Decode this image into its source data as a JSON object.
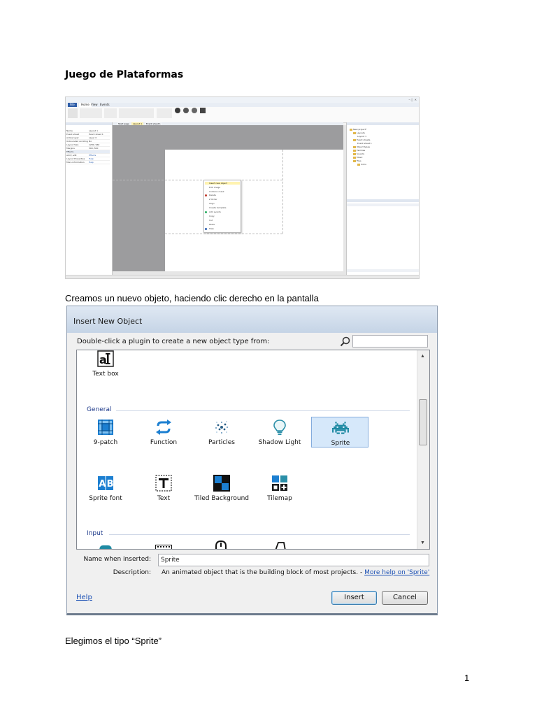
{
  "document": {
    "title": "Juego de Plataformas",
    "caption_1": "Creamos un nuevo objeto, haciendo clic derecho en la pantalla",
    "caption_2": "Elegimos el tipo “Sprite”",
    "page_number": "1"
  },
  "editor_screenshot": {
    "tabs": [
      "File",
      "Home",
      "View",
      "Events"
    ],
    "document_tabs": [
      "Start page",
      "Layout 1",
      "Event sheet 1"
    ],
    "properties": [
      {
        "name": "Name",
        "value": "Layout 1"
      },
      {
        "name": "Event sheet",
        "value": "Event sheet 1"
      },
      {
        "name": "Active layer",
        "value": "Layer 0"
      },
      {
        "name": "Unbounded scrolling",
        "value": "No"
      },
      {
        "name": "Layout Size",
        "value": "1280, 960"
      },
      {
        "name": "Margins",
        "value": "500, 500"
      },
      {
        "name": "Effects",
        "value": ""
      },
      {
        "name": "Add / edit",
        "value": "Effects"
      },
      {
        "name": "Layout Properties",
        "value": "Help"
      },
      {
        "name": "More information",
        "value": "Help"
      }
    ],
    "context_menu": [
      "Insert new object",
      "Edit image",
      "Collision mask",
      "Delete",
      "Z Order",
      "Align",
      "Create template",
      "Add events",
      "Copy",
      "Cut",
      "Paste",
      "Help"
    ],
    "project_tree": [
      "New project*",
      "Layouts",
      "Layout 1",
      "Event sheets",
      "Event sheet 1",
      "Object types",
      "Families",
      "Sounds",
      "Music",
      "Files",
      "Icons"
    ]
  },
  "dialog": {
    "title": "Insert New Object",
    "prompt": "Double-click a plugin to create a new object type from:",
    "search": {
      "value": "",
      "placeholder": ""
    },
    "partial_item": "Text box",
    "sections": [
      {
        "name": "General",
        "items": [
          {
            "label": "9-patch",
            "icon": "nine-patch-icon"
          },
          {
            "label": "Function",
            "icon": "function-icon"
          },
          {
            "label": "Particles",
            "icon": "particles-icon"
          },
          {
            "label": "Shadow Light",
            "icon": "lightbulb-icon"
          },
          {
            "label": "Sprite",
            "icon": "sprite-invader-icon",
            "selected": true
          },
          {
            "label": "Sprite font",
            "icon": "sprite-font-icon"
          },
          {
            "label": "Text",
            "icon": "text-icon"
          },
          {
            "label": "Tiled Background",
            "icon": "tiled-background-icon"
          },
          {
            "label": "Tilemap",
            "icon": "tilemap-icon"
          }
        ]
      },
      {
        "name": "Input"
      }
    ],
    "name_label": "Name when inserted:",
    "name_value": "Sprite",
    "description_label": "Description:",
    "description_text": "An animated object that is the building block of most projects.",
    "description_separator": " - ",
    "description_link": "More help on 'Sprite'",
    "help_link": "Help",
    "insert_button": "Insert",
    "cancel_button": "Cancel"
  },
  "colors": {
    "icon_blue": "#1c7fd1",
    "icon_teal": "#2b8fa8",
    "selection": "#d6e8fa",
    "section_text": "#1e3a8a",
    "link": "#1a4fb4"
  }
}
